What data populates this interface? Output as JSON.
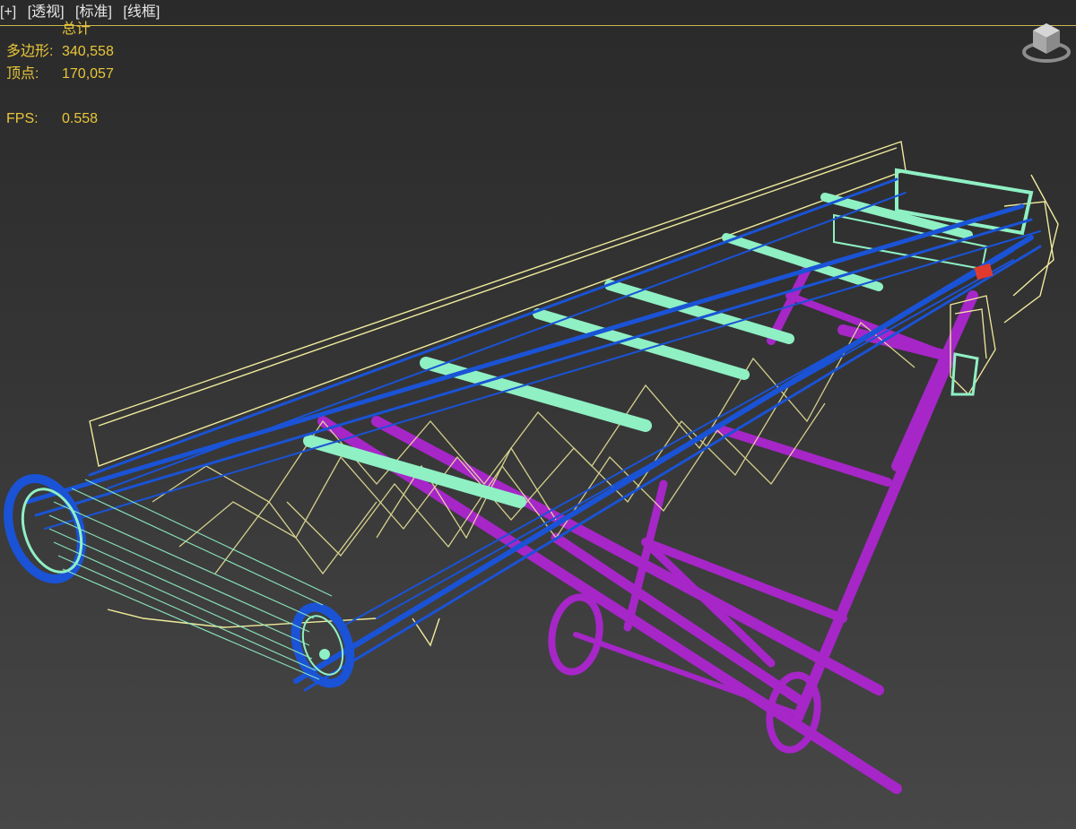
{
  "viewport": {
    "labels": [
      "[+]",
      "[透视]",
      "[标准]",
      "[线框]"
    ]
  },
  "stats": {
    "header": "总计",
    "polygons_label": "多边形:",
    "polygons_value": "340,558",
    "vertices_label": "顶点:",
    "vertices_value": "170,057",
    "fps_label": "FPS:",
    "fps_value": "0.558"
  },
  "viewcube": {
    "icon": "viewcube-icon"
  },
  "colors": {
    "overlay_text": "#e8c63a",
    "label_text": "#e6e6e6",
    "wire_yellow": "#f0eb9c",
    "wire_mint": "#8ff0c4",
    "wire_blue": "#1a53d6",
    "frame_purple": "#a626c8",
    "accent_red": "#e03a2f"
  }
}
